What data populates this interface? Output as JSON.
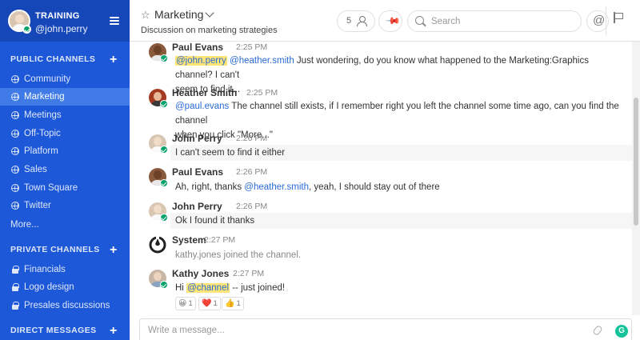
{
  "team": {
    "name": "TRAINING",
    "user": "@john.perry"
  },
  "sidebar": {
    "public_title": "PUBLIC CHANNELS",
    "public_channels": [
      "Community",
      "Marketing",
      "Meetings",
      "Off-Topic",
      "Platform",
      "Sales",
      "Town Square",
      "Twitter"
    ],
    "active_channel": "Marketing",
    "more": "More...",
    "private_title": "PRIVATE CHANNELS",
    "private_channels": [
      "Financials",
      "Logo design",
      "Presales discussions"
    ],
    "direct_title": "DIRECT MESSAGES",
    "plus": "+"
  },
  "header": {
    "channel_name": "Marketing",
    "purpose": "Discussion on marketing strategies",
    "member_count": "5",
    "search_placeholder": "Search",
    "star": "☆",
    "at": "@"
  },
  "posts": [
    {
      "user": "Paul Evans",
      "time": "2:25 PM",
      "mentions": [
        "@john.perry",
        "@heather.smith"
      ],
      "text": " Just wondering, do you know what happened to the Marketing:Graphics channel? I can't",
      "text2": "seem to find it..."
    },
    {
      "user": "Heather Smith",
      "time": "2:25 PM",
      "mentions": [
        "@paul.evans"
      ],
      "text": " The channel still exists, if I remember right you left the channel some time ago, can you find the channel",
      "text2": "when you click \"More...\""
    },
    {
      "user": "John Perry",
      "time": "2:26 PM",
      "text": "I can't seem to find it either"
    },
    {
      "user": "Paul Evans",
      "time": "2:26 PM",
      "text_a": "Ah, right, thanks ",
      "mention": "@heather.smith",
      "text_b": ", yeah, I should stay out of there"
    },
    {
      "user": "John Perry",
      "time": "2:26 PM",
      "text": "Ok I found it thanks"
    },
    {
      "user": "System",
      "time": "2:27 PM",
      "text": "kathy.jones joined the channel."
    },
    {
      "user": "Kathy Jones",
      "time": "2:27 PM",
      "text_a": "Hi ",
      "mention": "@channel",
      "text_b": " -- just joined!"
    }
  ],
  "reactions": [
    {
      "emoji": "😀",
      "count": "1"
    },
    {
      "emoji": "❤️",
      "count": "1"
    },
    {
      "emoji": "👍",
      "count": "1"
    }
  ],
  "composer": {
    "placeholder": "Write a message...",
    "grammarly": "G"
  },
  "colors": {
    "sidebar": "#1d58d8",
    "sidebar_active": "#3f7ae6",
    "mention": "#2a6bd6",
    "mention_highlight": "#ffe577",
    "online": "#06a36b"
  }
}
